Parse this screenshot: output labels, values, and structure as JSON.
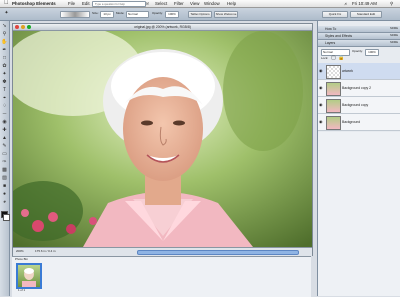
{
  "menubar": {
    "app_name": "Photoshop Elements",
    "items": [
      "File",
      "Edit",
      "Image",
      "Enhance",
      "Layer",
      "Select",
      "Filter",
      "View",
      "Window",
      "Help"
    ],
    "clock": "Fri 10:49 AM"
  },
  "options_bar": {
    "size_label": "Size:",
    "size_value": "13 px",
    "mode_label": "Mode:",
    "mode_value": "Normal",
    "opacity_label": "Opacity:",
    "opacity_value": "100%",
    "help_placeholder": "Type a question for help",
    "btn_a": "Tablet Options",
    "btn_b": "Show Welcome",
    "quickfix": "Quick Fix",
    "standard_edit": "Standard Edit"
  },
  "document": {
    "title": "original.jpg @ 200% (artwork, RGB/8)",
    "zoom": "200%",
    "info": "175.6 in / 0.4 in"
  },
  "photo_bin": {
    "title": "Photo Bin",
    "page": "1 of 1"
  },
  "panels": {
    "how_to": "How To",
    "styles": "Styles and Effects",
    "layers": "Layers",
    "more": "MORE",
    "blend_mode": "Normal",
    "opacity_label": "Opacity:",
    "opacity_value": "100%",
    "lock_label": "Lock:"
  },
  "layers": [
    {
      "name": "artwork"
    },
    {
      "name": "Background copy 2"
    },
    {
      "name": "Background copy"
    },
    {
      "name": "Background"
    }
  ],
  "colors": {
    "accent": "#5d86c2",
    "chrome": "#b8c3cf",
    "menubar": "#e6e6e6"
  }
}
